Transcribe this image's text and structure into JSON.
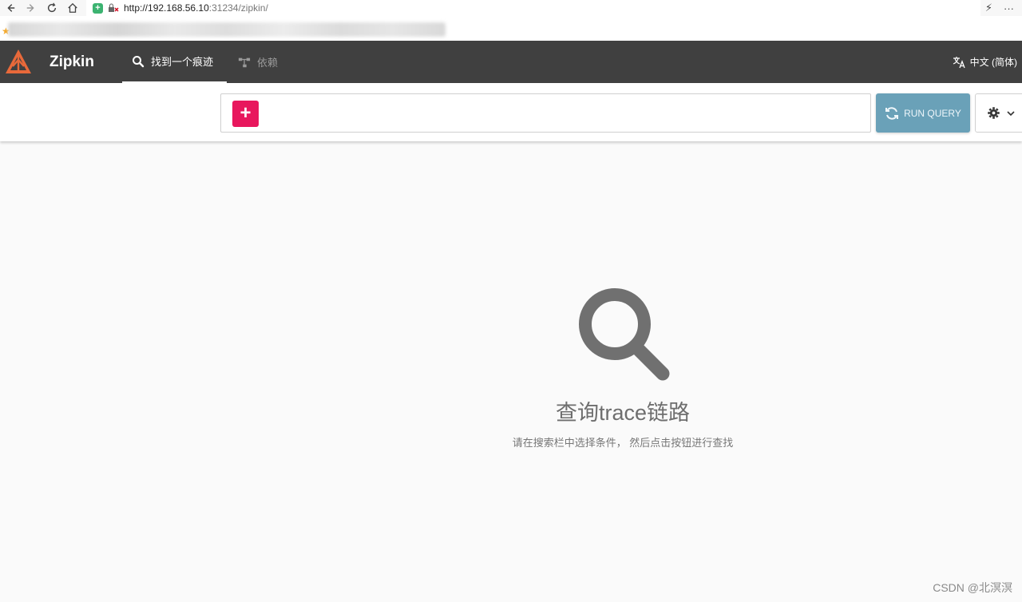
{
  "browser": {
    "url_host": "http://192.168.56.10",
    "url_rest": ":31234/zipkin/",
    "more_label": "···"
  },
  "app": {
    "brand": "Zipkin",
    "tabs": [
      {
        "label": "找到一个痕迹",
        "icon": "search-icon",
        "active": true
      },
      {
        "label": "依赖",
        "icon": "dependencies-icon",
        "active": false
      }
    ],
    "language": "中文 (简体)"
  },
  "toolbar": {
    "add_label": "+",
    "run_query_label": "RUN QUERY"
  },
  "empty_state": {
    "title": "查询trace链路",
    "subtitle": "请在搜索栏中选择条件， 然后点击按钮进行查找"
  },
  "watermark": "CSDN @北溟溟",
  "colors": {
    "header_bg": "#404040",
    "add_button": "#e8175d",
    "run_query_button": "#6aa1b8",
    "logo_orange": "#e8693a"
  }
}
